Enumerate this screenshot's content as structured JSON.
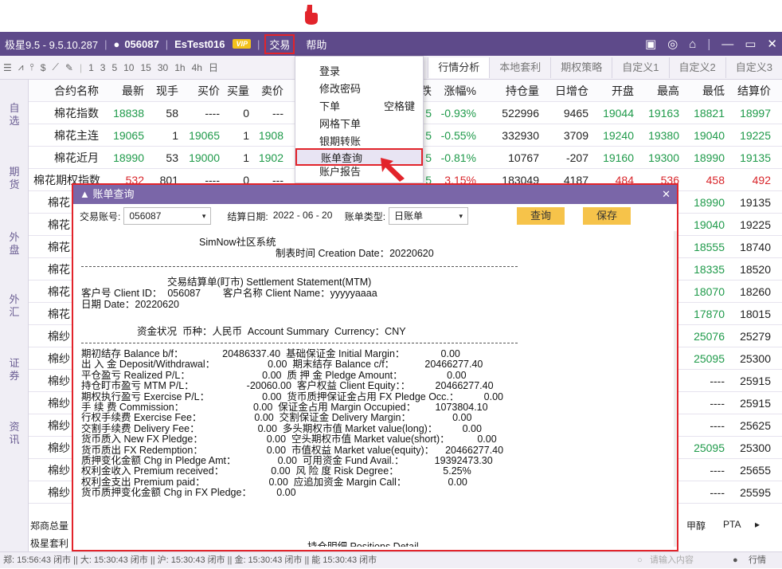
{
  "title_bar": {
    "app_name": "极星9.5 - 9.5.10.287",
    "user_id": "056087",
    "account": "EsTest016",
    "vip": "VIP",
    "menu_trade": "交易",
    "menu_help": "帮助"
  },
  "toolbar": {
    "intervals": [
      "1",
      "3",
      "5",
      "10",
      "15",
      "30",
      "1h",
      "4h",
      "日"
    ]
  },
  "tabs": [
    "行情分析",
    "本地套利",
    "期权策略",
    "自定义1",
    "自定义2",
    "自定义3"
  ],
  "sidebar": [
    "自选",
    "期货",
    "外盘",
    "外汇",
    "证券",
    "资讯"
  ],
  "quote": {
    "headers": [
      "合约名称",
      "最新",
      "现手",
      "买价",
      "买量",
      "卖价",
      "跌",
      "涨幅%",
      "持仓量",
      "日增仓",
      "开盘",
      "最高",
      "最低",
      "结算价"
    ],
    "rows": [
      {
        "name": "棉花指数",
        "last": "18838",
        "vol": "58",
        "bid": "----",
        "bidv": "0",
        "ask": "---",
        "chg": "5",
        "pct": "-0.93%",
        "oi": "522996",
        "doi": "9465",
        "open": "19044",
        "high": "19163",
        "low": "18821",
        "settle": "18997"
      },
      {
        "name": "棉花主连",
        "last": "19065",
        "vol": "1",
        "bid": "19065",
        "bidv": "1",
        "ask": "1908",
        "chg": "5",
        "pct": "-0.55%",
        "oi": "332930",
        "doi": "3709",
        "open": "19240",
        "high": "19380",
        "low": "19040",
        "settle": "19225"
      },
      {
        "name": "棉花近月",
        "last": "18990",
        "vol": "53",
        "bid": "19000",
        "bidv": "1",
        "ask": "1902",
        "chg": "5",
        "pct": "-0.81%",
        "oi": "10767",
        "doi": "-207",
        "open": "19160",
        "high": "19300",
        "low": "18990",
        "settle": "19135"
      },
      {
        "name": "棉花期权指数",
        "last": "532",
        "vol": "801",
        "bid": "----",
        "bidv": "0",
        "ask": "---",
        "chg": "5",
        "pct": "3.15%",
        "oi": "183049",
        "doi": "4187",
        "open": "484",
        "high": "536",
        "low": "458",
        "settle": "492"
      }
    ],
    "hidden_rows": [
      {
        "name": "棉花",
        "low": "18990",
        "settle": "19135"
      },
      {
        "name": "棉花",
        "low": "19040",
        "settle": "19225"
      },
      {
        "name": "棉花",
        "low": "18555",
        "settle": "18740"
      },
      {
        "name": "棉花",
        "low": "18335",
        "settle": "18520"
      },
      {
        "name": "棉花",
        "low": "18070",
        "settle": "18260"
      },
      {
        "name": "棉花",
        "low": "17870",
        "settle": "18015"
      },
      {
        "name": "棉纱",
        "low": "25076",
        "settle": "25279"
      },
      {
        "name": "棉纱",
        "low": "25095",
        "settle": "25300"
      },
      {
        "name": "棉纱",
        "low": "----",
        "settle": "25915"
      },
      {
        "name": "棉纱",
        "low": "----",
        "settle": "25915"
      },
      {
        "name": "棉纱",
        "low": "----",
        "settle": "25625"
      },
      {
        "name": "棉纱",
        "low": "25095",
        "settle": "25300"
      },
      {
        "name": "棉纱",
        "low": "----",
        "settle": "25655"
      },
      {
        "name": "棉纱",
        "low": "----",
        "settle": "25595"
      }
    ]
  },
  "menu": {
    "items": [
      {
        "label": "登录",
        "shortcut": ""
      },
      {
        "label": "修改密码",
        "shortcut": ""
      },
      {
        "label": "下单",
        "shortcut": "空格键"
      },
      {
        "label": "网格下单",
        "shortcut": ""
      },
      {
        "label": "银期转账",
        "shortcut": ""
      },
      {
        "label": "账单查询",
        "shortcut": ""
      },
      {
        "label": "账户报告",
        "shortcut": ""
      }
    ]
  },
  "dialog": {
    "title": "账单查询",
    "account_label": "交易账号:",
    "account_value": "056087",
    "date_label": "结算日期:",
    "date_value": "2022 - 06 - 20",
    "type_label": "账单类型:",
    "type_value": "日账单",
    "query_btn": "查询",
    "save_btn": "保存",
    "statement": {
      "header1": "SimNow社区系统",
      "header2": "制表时间 Creation Date：20220620",
      "title": "交易结算单(盯市) Settlement Statement(MTM)",
      "client": "客户号 Client ID：  056087        客户名称 Client Name：yyyyyaaaa",
      "date": "日期 Date：20220620",
      "summary_title": "资金状况  币种：人民币  Account Summary  Currency：CNY",
      "lines": [
        "期初结存 Balance b/f：              20486337.40  基础保证金 Initial Margin：             0.00",
        "出 入 金 Deposit/Withdrawal：                   0.00  期末结存 Balance c/f：           20466277.40",
        "平仓盈亏 Realized P/L：                          0.00  质 押 金 Pledge Amount：                0.00",
        "持仓盯市盈亏 MTM P/L：                   -20060.00  客户权益 Client Equity：：         20466277.40",
        "期权执行盈亏 Exercise P/L：                   0.00  货币质押保证金占用 FX Pledge Occ.：         0.00",
        "手 续 费 Commission：                         0.00  保证金占用 Margin Occupied：       1073804.10",
        "行权手续费 Exercise Fee：                   0.00  交割保证金 Delivery Margin：               0.00",
        "交割手续费 Delivery Fee：                     0.00  多头期权市值 Market value(long)：         0.00",
        "货币质入 New FX Pledge：                       0.00  空头期权市值 Market value(short)：          0.00",
        "货币质出 FX Redemption：                       0.00  市值权益 Market value(equity)：    20466277.40",
        "质押变化金额 Chg in Pledge Amt：               0.00  可用资金 Fund Avail.：           19392473.30",
        "权利金收入 Premium received：                 0.00  风 险 度 Risk Degree：                5.25%",
        "权利金支出 Premium paid：                       0.00  应追加资金 Margin Call：               0.00",
        "货币质押变化金额 Chg in FX Pledge：         0.00"
      ],
      "positions_title": "持仓明细 Positions Detail"
    }
  },
  "bottom": {
    "left": "郑商总量",
    "left2": "极星套利",
    "right": [
      "甲醇",
      "PTA",
      "▸"
    ]
  },
  "status": {
    "text": "郑: 15:56:43  闭市 || 大: 15:30:43  闭市 || 沪: 15:30:43  闭市 || 金: 15:30:43  闭市 || 能 15:30:43  闭市",
    "search": "请输入内容",
    "quote": "行情"
  },
  "colors": {
    "accent": "#5e4a8a",
    "highlight": "#e2242b",
    "up": "#d8262b",
    "down": "#1f9a4a",
    "button": "#f6c34a"
  }
}
